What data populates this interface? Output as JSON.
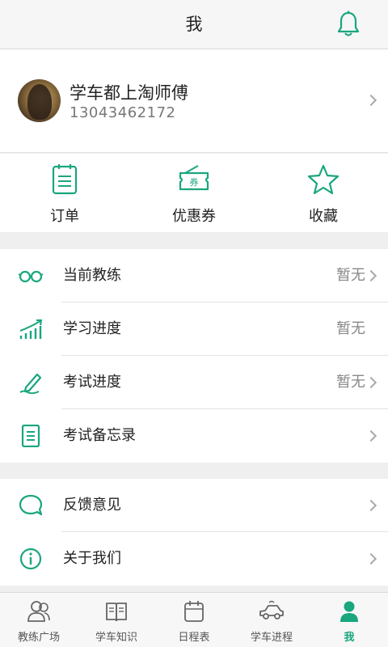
{
  "header": {
    "title": "我",
    "bell_icon": "bell-icon"
  },
  "profile": {
    "name": "学车都上淘师傅",
    "phone": "13043462172",
    "avatar": "avatar"
  },
  "quick_actions": [
    {
      "label": "订单",
      "icon": "order-icon"
    },
    {
      "label": "优惠券",
      "icon": "coupon-icon"
    },
    {
      "label": "收藏",
      "icon": "star-icon"
    }
  ],
  "menu_group_1": [
    {
      "label": "当前教练",
      "value": "暂无",
      "icon": "glasses-icon",
      "chevron": true
    },
    {
      "label": "学习进度",
      "value": "暂无",
      "icon": "chart-icon",
      "chevron": false
    },
    {
      "label": "考试进度",
      "value": "暂无",
      "icon": "pencil-icon",
      "chevron": true
    },
    {
      "label": "考试备忘录",
      "value": "",
      "icon": "memo-icon",
      "chevron": true
    }
  ],
  "menu_group_2": [
    {
      "label": "反馈意见",
      "icon": "feedback-icon",
      "chevron": true
    },
    {
      "label": "关于我们",
      "icon": "info-icon",
      "chevron": true
    }
  ],
  "tabbar": [
    {
      "label": "教练广场",
      "icon": "coach-icon",
      "active": false
    },
    {
      "label": "学车知识",
      "icon": "book-icon",
      "active": false
    },
    {
      "label": "日程表",
      "icon": "calendar-icon",
      "active": false
    },
    {
      "label": "学车进程",
      "icon": "car-icon",
      "active": false
    },
    {
      "label": "我",
      "icon": "person-icon",
      "active": true
    }
  ],
  "colors": {
    "accent": "#1aa67f",
    "background": "#efefef"
  }
}
